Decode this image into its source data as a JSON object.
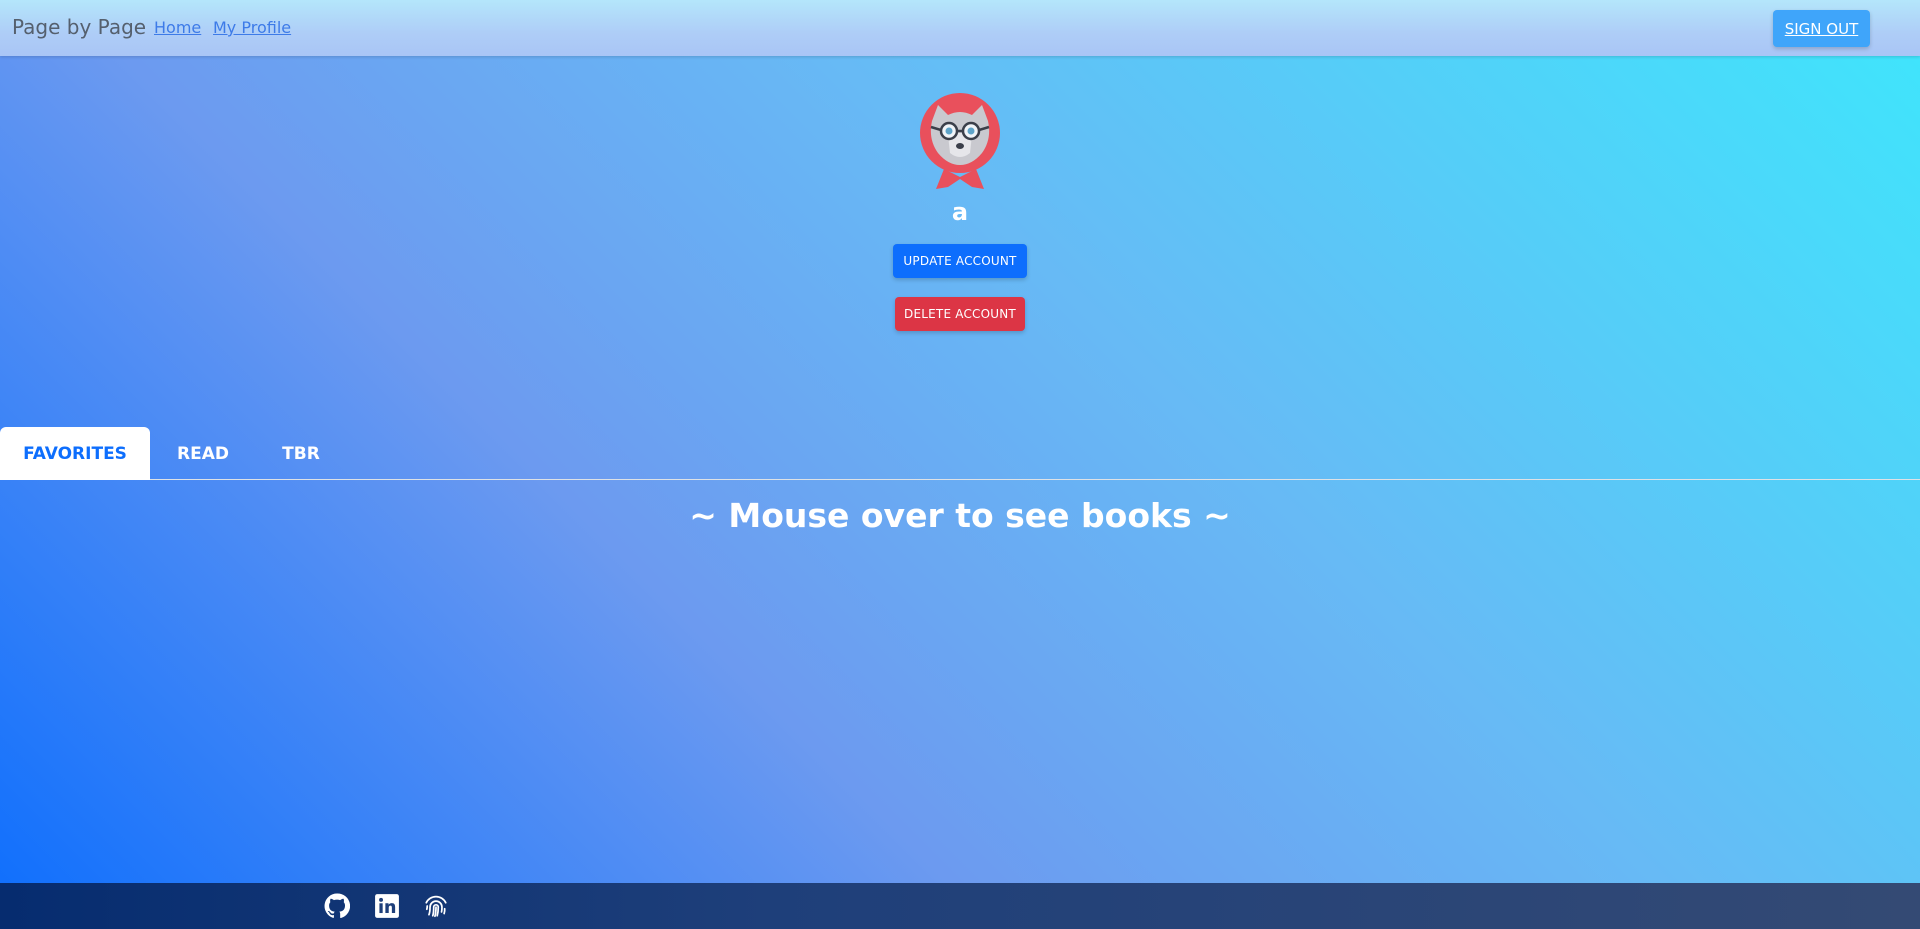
{
  "navbar": {
    "brand": "Page by Page",
    "links": [
      {
        "label": "Home"
      },
      {
        "label": "My Profile"
      }
    ],
    "signout_label": "SIGN OUT"
  },
  "profile": {
    "avatar_icon": "wolf-with-glasses-avatar-icon",
    "username": "a",
    "update_label": "UPDATE ACCOUNT",
    "delete_label": "DELETE ACCOUNT"
  },
  "tabs": [
    {
      "label": "FAVORITES",
      "active": true
    },
    {
      "label": "READ",
      "active": false
    },
    {
      "label": "TBR",
      "active": false
    }
  ],
  "content": {
    "hint": "~ Mouse over to see books ~"
  },
  "footer": {
    "icons": [
      "github-icon",
      "linkedin-icon",
      "fingerprint-icon"
    ]
  },
  "colors": {
    "primary": "#0d6efd",
    "danger": "#dc3545",
    "signout": "#3fa5fa",
    "avatar_ring": "#e9505c"
  }
}
